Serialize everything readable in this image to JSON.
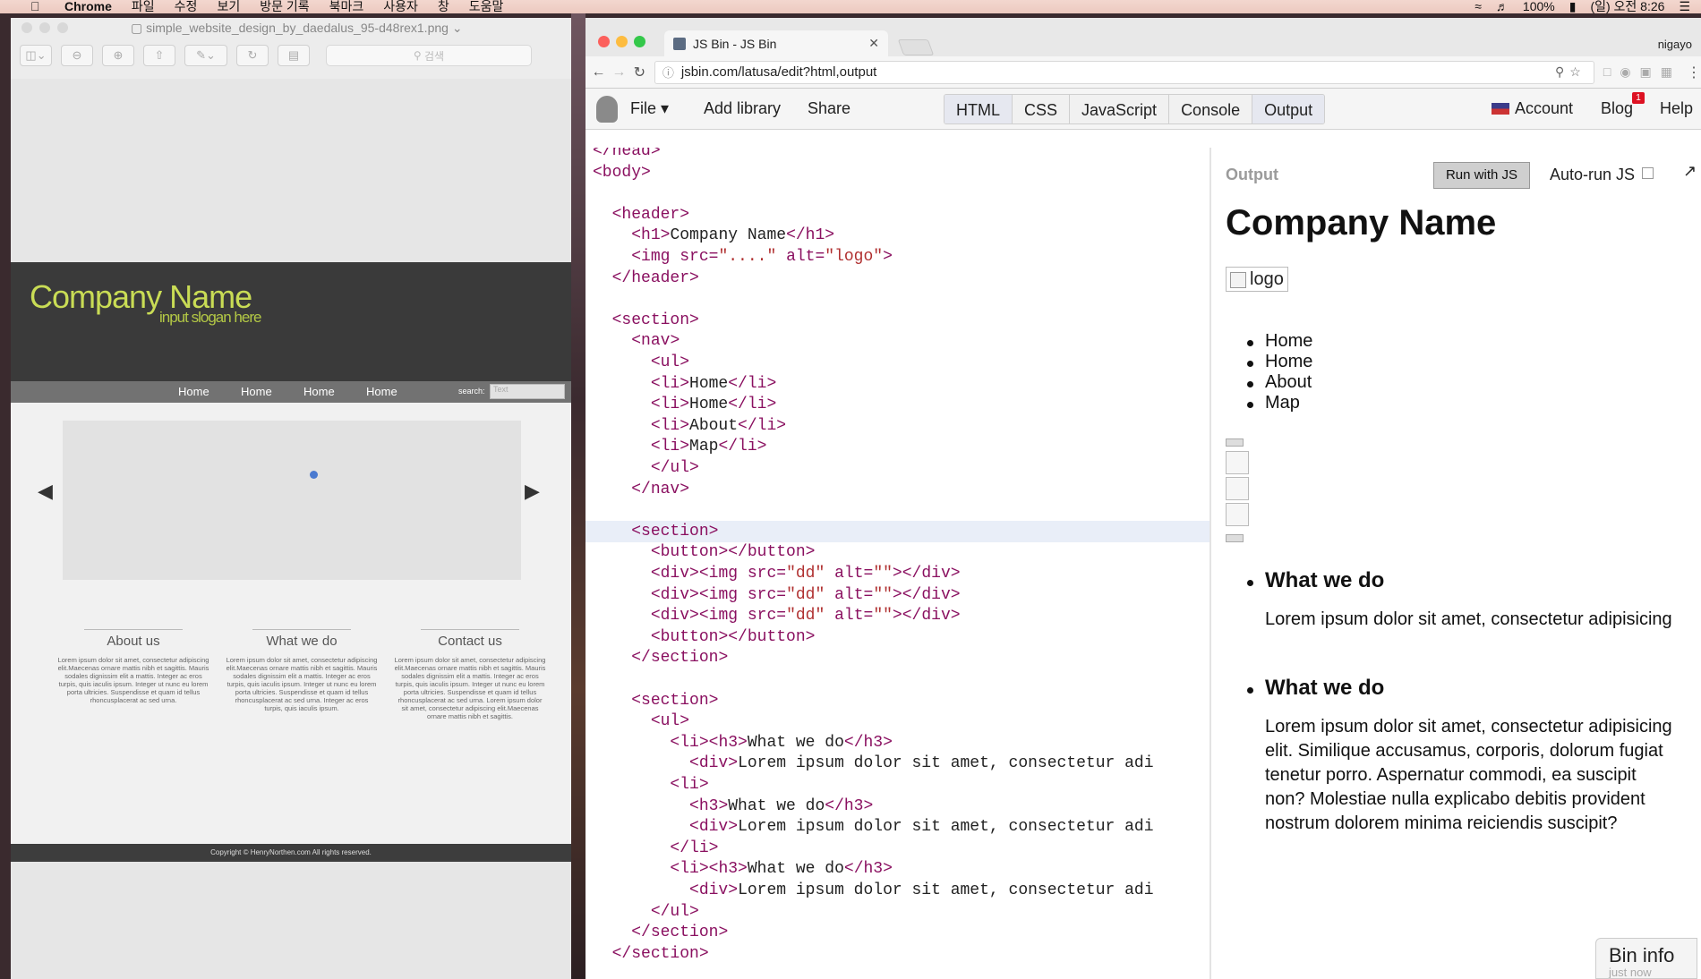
{
  "menubar": {
    "app": "Chrome",
    "items": [
      "파일",
      "수정",
      "보기",
      "방문 기록",
      "북마크",
      "사용자",
      "창",
      "도움말"
    ],
    "status": {
      "battery": "100%",
      "clock": "(일) 오전 8:26"
    }
  },
  "preview": {
    "filename": "simple_website_design_by_daedalus_95-d48rex1.png",
    "search_placeholder": "검색",
    "mock": {
      "company": "Company Name",
      "slogan": "input slogan here",
      "nav": [
        "Home",
        "Home",
        "Home",
        "Home"
      ],
      "search_label": "search:",
      "search_value": "Text",
      "columns": [
        {
          "title": "About us",
          "text": "Lorem ipsum dolor sit amet, consectetur adipiscing elit.Maecenas ornare mattis nibh et sagittis. Mauris sodales dignissim elit a mattis. Integer ac eros turpis, quis iaculis ipsum. Integer ut nunc eu lorem porta ultricies. Suspendisse et quam id tellus rhoncusplacerat ac sed urna."
        },
        {
          "title": "What we do",
          "text": "Lorem ipsum dolor sit amet, consectetur adipiscing elit.Maecenas ornare mattis nibh et sagittis. Mauris sodales dignissim elit a mattis. Integer ac eros turpis, quis iaculis ipsum. Integer ut nunc eu lorem porta ultricies. Suspendisse et quam id tellus rhoncusplacerat ac sed urna. Integer ac eros turpis, quis iaculis ipsum."
        },
        {
          "title": "Contact us",
          "text": "Lorem ipsum dolor sit amet, consectetur adipiscing elit.Maecenas ornare mattis nibh et sagittis. Mauris sodales dignissim elit a mattis. Integer ac eros turpis, quis iaculis ipsum. Integer ut nunc eu lorem porta ultricies. Suspendisse et quam id tellus rhoncusplacerat ac sed urna. Lorem ipsum dolor sit amet, consectetur adipiscing elit.Maecenas ornare mattis nibh et sagittis."
        }
      ],
      "footer": "Copyright © HenryNorthen.com All rights reserved."
    }
  },
  "chrome": {
    "tab_title": "JS Bin - JS Bin",
    "profile": "nigayo",
    "url": "jsbin.com/latusa/edit?html,output"
  },
  "jsbin": {
    "file": "File",
    "add_library": "Add library",
    "share": "Share",
    "panels": [
      "HTML",
      "CSS",
      "JavaScript",
      "Console",
      "Output"
    ],
    "account": "Account",
    "blog": "Blog",
    "blog_badge": "1",
    "help": "Help",
    "output_label": "Output",
    "run_button": "Run with JS",
    "autorun": "Auto-run JS",
    "bin_info": "Bin info",
    "bin_info_sub": "just now"
  },
  "code_lines": [
    "</head>",
    "<body>",
    "",
    "  <header>",
    "    <h1>Company Name</h1>",
    "    <img src=\"....\" alt=\"logo\">",
    "  </header>",
    "",
    "  <section>",
    "    <nav>",
    "      <ul>",
    "      <li>Home</li>",
    "      <li>Home</li>",
    "      <li>About</li>",
    "      <li>Map</li>",
    "      </ul>",
    "    </nav>",
    "",
    "    <section>",
    "      <button></button>",
    "      <div><img src=\"dd\" alt=\"\"></div>",
    "      <div><img src=\"dd\" alt=\"\"></div>",
    "      <div><img src=\"dd\" alt=\"\"></div>",
    "      <button></button>",
    "    </section>",
    "",
    "    <section>",
    "      <ul>",
    "        <li><h3>What we do</h3>",
    "          <div>Lorem ipsum dolor sit amet, consectetur adi",
    "        <li>",
    "          <h3>What we do</h3>",
    "          <div>Lorem ipsum dolor sit amet, consectetur adi",
    "        </li>",
    "        <li><h3>What we do</h3>",
    "          <div>Lorem ipsum dolor sit amet, consectetur adi",
    "      </ul>",
    "    </section>",
    "  </section>"
  ],
  "output": {
    "h1": "Company Name",
    "logo_alt": "logo",
    "nav": [
      "Home",
      "Home",
      "About",
      "Map"
    ],
    "items": [
      {
        "h3": "What we do",
        "p": "Lorem ipsum dolor sit amet, consectetur adipisicing"
      },
      {
        "h3": "What we do",
        "p": "Lorem ipsum dolor sit amet, consectetur adipisicing elit. Similique accusamus, corporis, dolorum fugiat tenetur porro. Aspernatur commodi, ea suscipit non? Molestiae nulla explicabo debitis provident nostrum dolorem minima reiciendis suscipit?"
      }
    ]
  }
}
